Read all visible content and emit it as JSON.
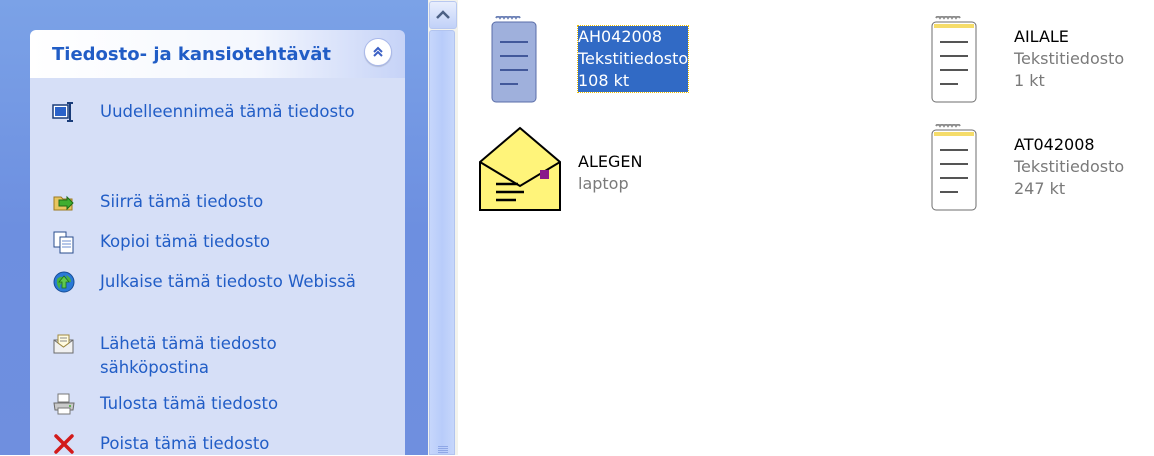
{
  "task_pane": {
    "title": "Tiedosto- ja kansiotehtävät",
    "tasks": [
      {
        "label": "Uudelleennimeä tämä tiedosto",
        "icon": "rename-icon"
      },
      {
        "label": "Siirrä tämä tiedosto",
        "icon": "move-icon"
      },
      {
        "label": "Kopioi tämä tiedosto",
        "icon": "copy-icon"
      },
      {
        "label": "Julkaise tämä tiedosto Webissä",
        "icon": "publish-web-icon"
      },
      {
        "label": "Lähetä tämä tiedosto sähköpostina",
        "icon": "email-icon"
      },
      {
        "label": "Tulosta tämä tiedosto",
        "icon": "print-icon"
      },
      {
        "label": "Poista tämä tiedosto",
        "icon": "delete-icon"
      }
    ]
  },
  "files": [
    {
      "name": "AH042008",
      "type": "Tekstitiedosto",
      "size": "108 kt",
      "icon": "notepad-text-file-icon",
      "selected": true
    },
    {
      "name": "AILALE",
      "type": "Tekstitiedosto",
      "size": "1 kt",
      "icon": "notepad-text-file-icon",
      "selected": false
    },
    {
      "name": "ALEGEN",
      "type": "laptop",
      "size": "",
      "icon": "envelope-file-icon",
      "selected": false
    },
    {
      "name": "AT042008",
      "type": "Tekstitiedosto",
      "size": "247 kt",
      "icon": "notepad-text-file-icon",
      "selected": false
    }
  ],
  "colors": {
    "pane_gradient": "#7ba2e7",
    "link": "#215dc6",
    "selection": "#316ac5"
  }
}
